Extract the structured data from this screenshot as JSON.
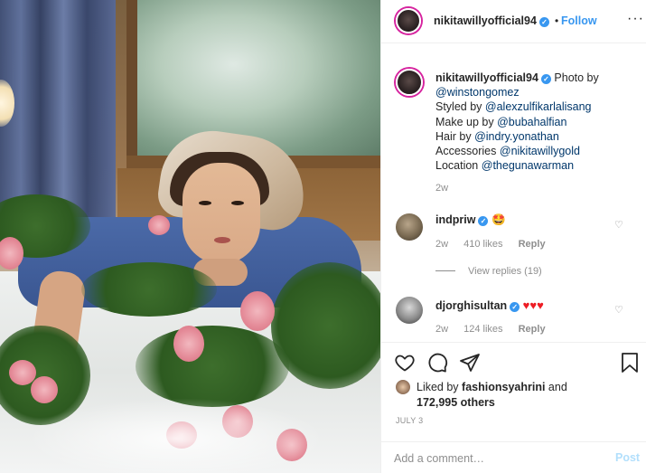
{
  "post": {
    "username": "nikitawillyofficial94",
    "verified_icon": "verified-badge-icon",
    "separator": "•",
    "follow_label": "Follow",
    "more_label": "···",
    "accent_color": "#3897f0"
  },
  "caption": {
    "username": "nikitawillyofficial94",
    "lines": [
      {
        "prefix": "Photo by",
        "mention": ""
      },
      {
        "prefix": "",
        "mention": "@winstongomez"
      },
      {
        "prefix": "Styled by",
        "mention": "@alexzulfikarlalisang"
      },
      {
        "prefix": "Make up by",
        "mention": "@bubahalfian"
      },
      {
        "prefix": "Hair by",
        "mention": "@indry.yonathan"
      },
      {
        "prefix": "Accessories",
        "mention": "@nikitawillygold"
      },
      {
        "prefix": "Location",
        "mention": "@thegunawarman"
      }
    ],
    "time": "2w"
  },
  "comments": [
    {
      "username": "indpriw",
      "body": "🤩",
      "time": "2w",
      "likes": "410 likes",
      "reply": "Reply"
    },
    {
      "username": "djorghisultan",
      "body": "♥♥♥",
      "time": "2w",
      "likes": "124 likes",
      "reply": "Reply"
    }
  ],
  "view_replies": "View replies (19)",
  "liked_by": {
    "prefix": "Liked by",
    "user": "fashionsyahrini",
    "joiner": "and",
    "others": "172,995 others"
  },
  "date": "JULY 3",
  "add_comment": {
    "placeholder": "Add a comment…",
    "post_label": "Post"
  }
}
